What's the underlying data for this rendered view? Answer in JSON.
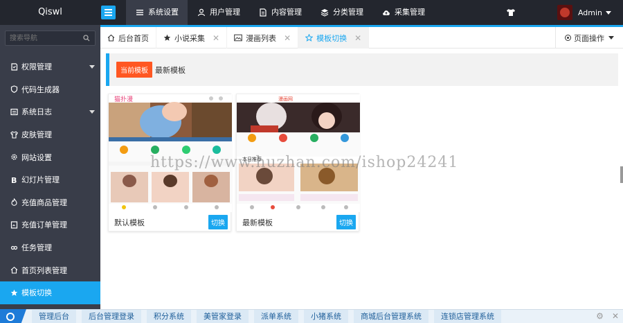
{
  "app": {
    "logo": "Qiswl"
  },
  "nav": [
    {
      "label": "系统设置",
      "icon": "list-icon",
      "active": true
    },
    {
      "label": "用户管理",
      "icon": "user-icon",
      "active": false
    },
    {
      "label": "内容管理",
      "icon": "document-icon",
      "active": false
    },
    {
      "label": "分类管理",
      "icon": "layers-icon",
      "active": false
    },
    {
      "label": "采集管理",
      "icon": "cloud-upload-icon",
      "active": false
    }
  ],
  "user": {
    "name": "Admin"
  },
  "sidebar": {
    "search_placeholder": "搜索导航",
    "items": [
      {
        "label": "权限管理",
        "icon": "permission-icon",
        "arrow": true
      },
      {
        "label": "代码生成器",
        "icon": "shield-icon"
      },
      {
        "label": "系统日志",
        "icon": "log-icon",
        "arrow": true
      },
      {
        "label": "皮肤管理",
        "icon": "skin-icon"
      },
      {
        "label": "网站设置",
        "icon": "settings-icon"
      },
      {
        "label": "幻灯片管理",
        "icon": "bold-b-icon"
      },
      {
        "label": "充值商品管理",
        "icon": "fire-icon"
      },
      {
        "label": "充值订单管理",
        "icon": "order-icon"
      },
      {
        "label": "任务管理",
        "icon": "link-icon"
      },
      {
        "label": "首页列表管理",
        "icon": "home-icon"
      },
      {
        "label": "模板切换",
        "icon": "star-icon",
        "active": true
      }
    ]
  },
  "tabs": [
    {
      "label": "后台首页",
      "icon": "home-icon",
      "closable": false
    },
    {
      "label": "小说采集",
      "icon": "star-icon",
      "closable": true
    },
    {
      "label": "漫画列表",
      "icon": "image-icon",
      "closable": true
    },
    {
      "label": "模板切换",
      "icon": "star-outline-icon",
      "closable": true,
      "active": true
    }
  ],
  "page_ops": {
    "label": "页面操作"
  },
  "notice": {
    "badge": "当前模板",
    "text": "最新模板"
  },
  "templates": [
    {
      "name": "默认模板",
      "button": "切换",
      "preview_header": "猫扑漫"
    },
    {
      "name": "最新模板",
      "button": "切换",
      "preview_header": "本日推荐"
    }
  ],
  "watermark": "https://www.huzhan.com/ishop24241",
  "taskbar": [
    "管理后台",
    "后台管理登录",
    "积分系统",
    "美管家登录",
    "派单系统",
    "小猪系统",
    "商城后台管理系统",
    "连锁店管理系统"
  ],
  "colors": {
    "accent": "#1aa7f0",
    "badge": "#ff5722",
    "topbar": "#23262e",
    "sidebar": "#393d49"
  }
}
